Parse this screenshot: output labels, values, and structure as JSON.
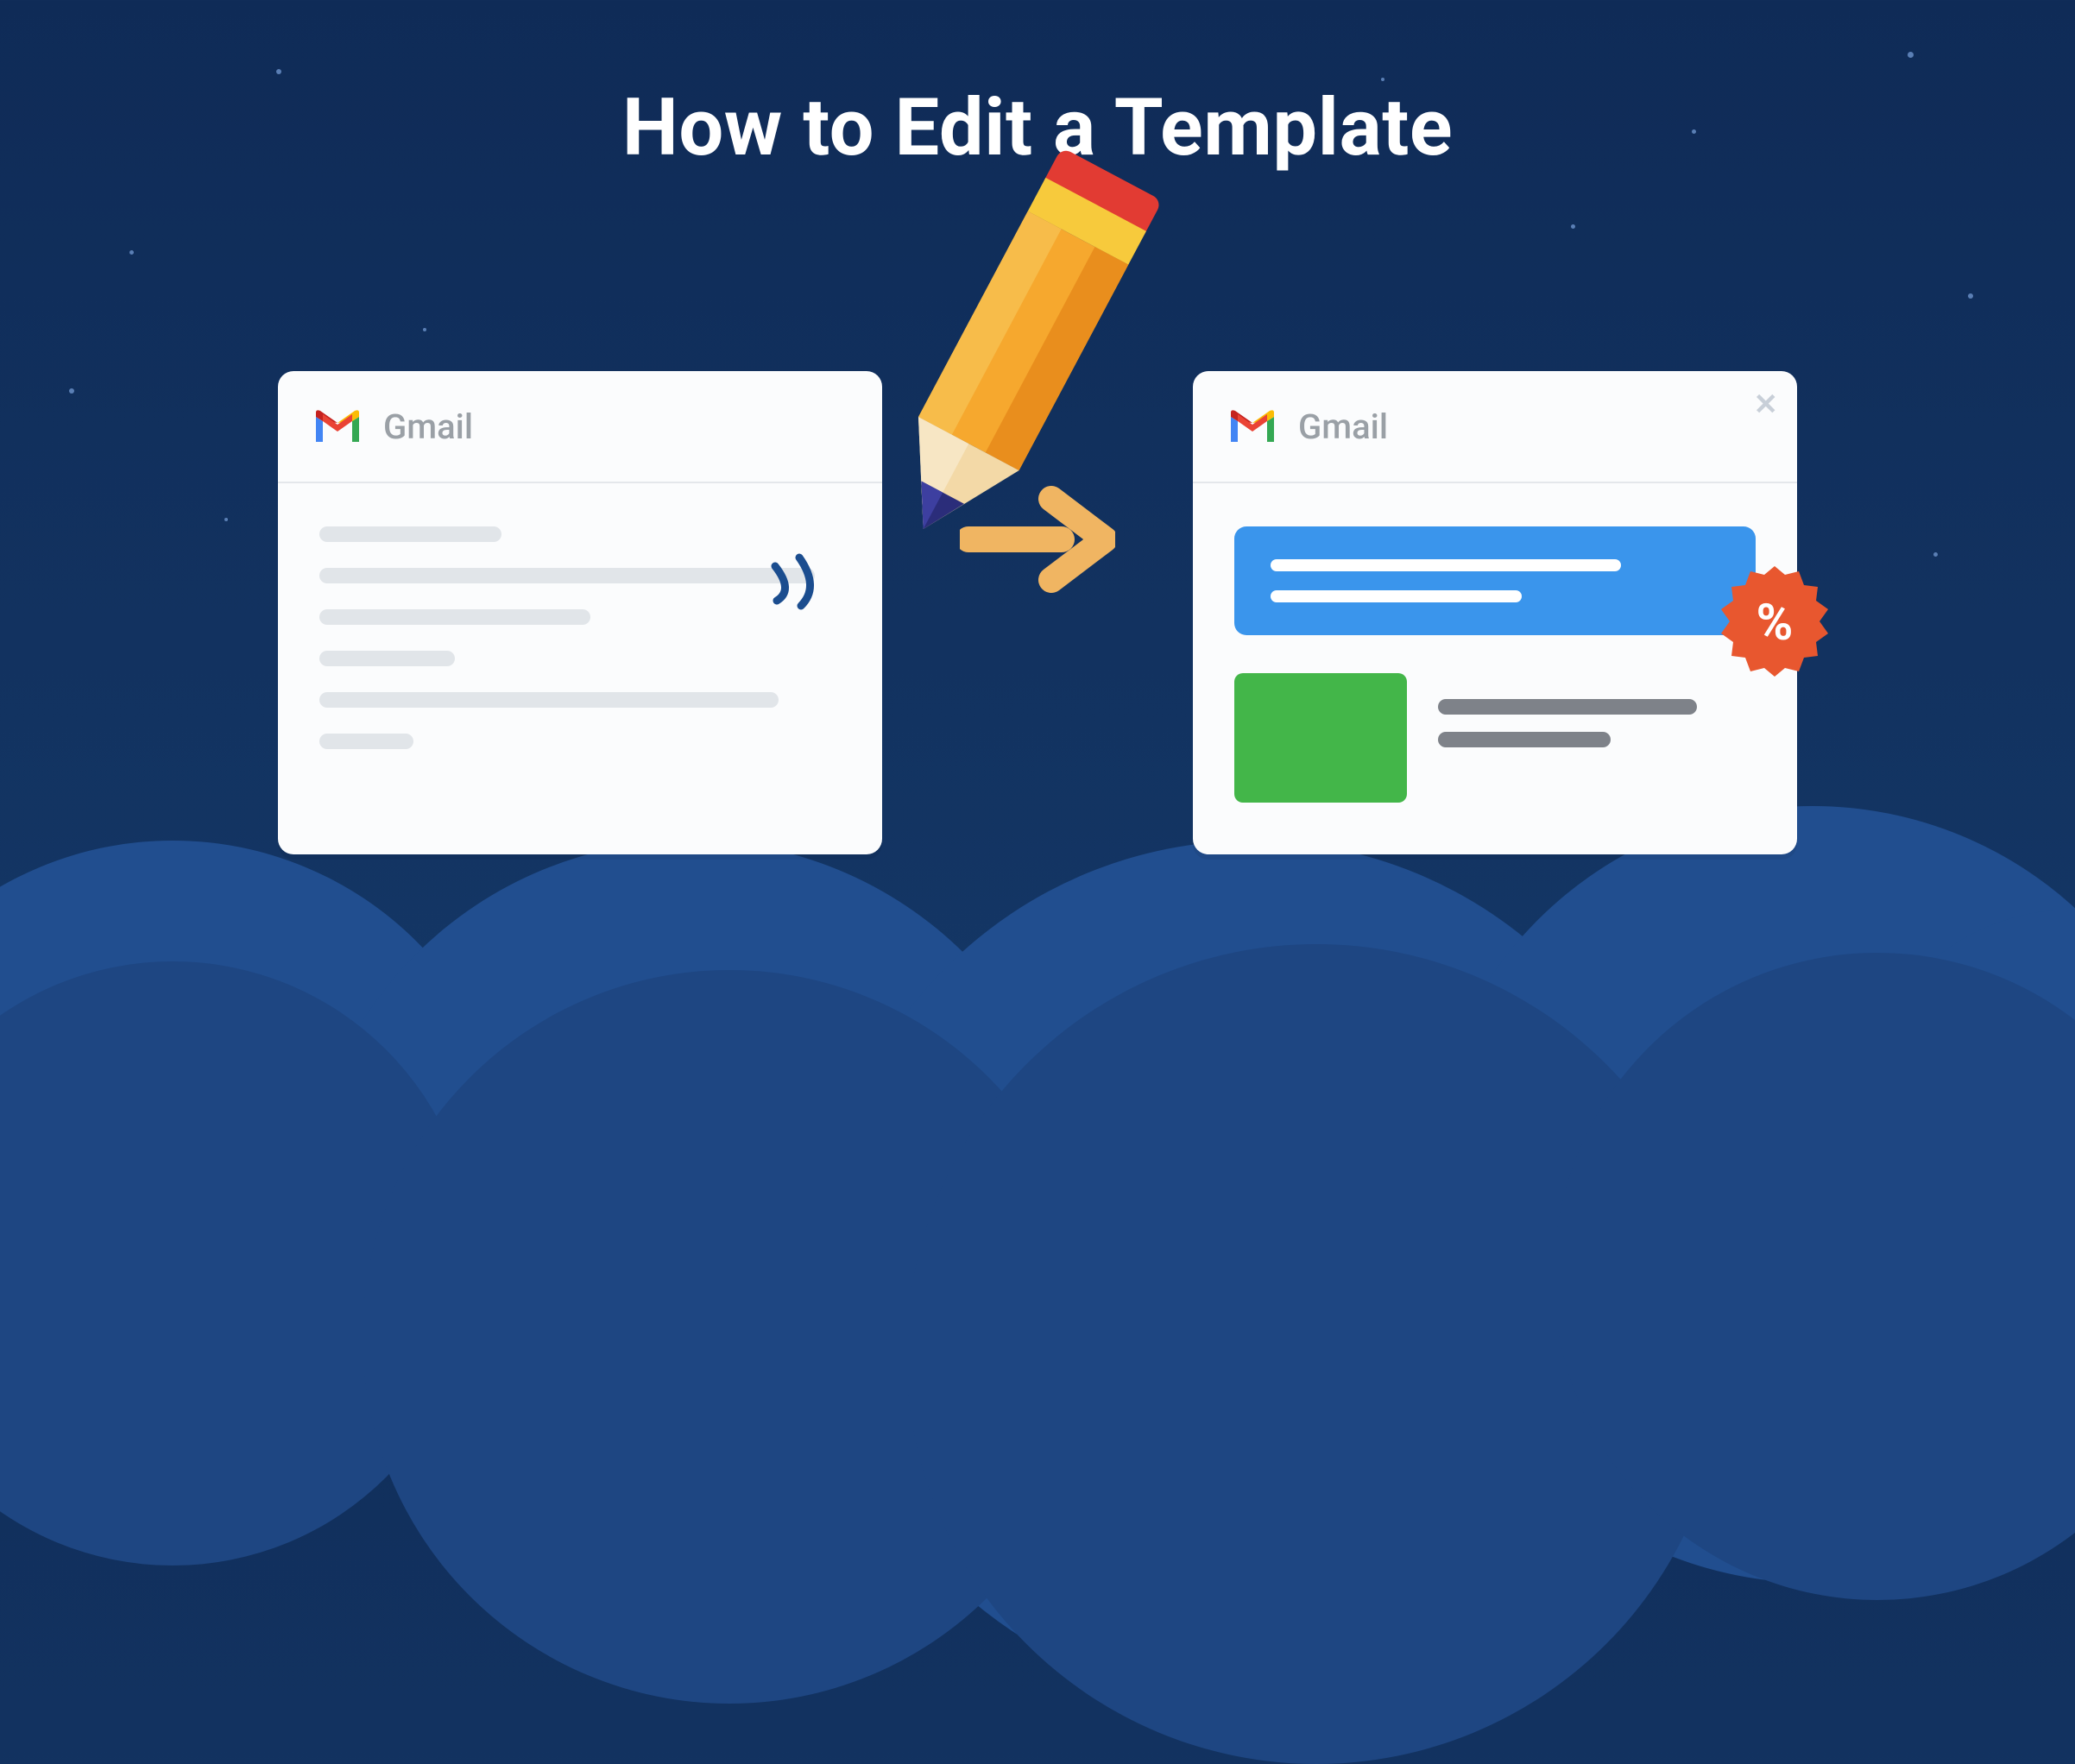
{
  "title": "How to Edit a Template",
  "left_card": {
    "app_label": "Gmail"
  },
  "right_card": {
    "app_label": "Gmail",
    "badge_symbol": "%"
  }
}
